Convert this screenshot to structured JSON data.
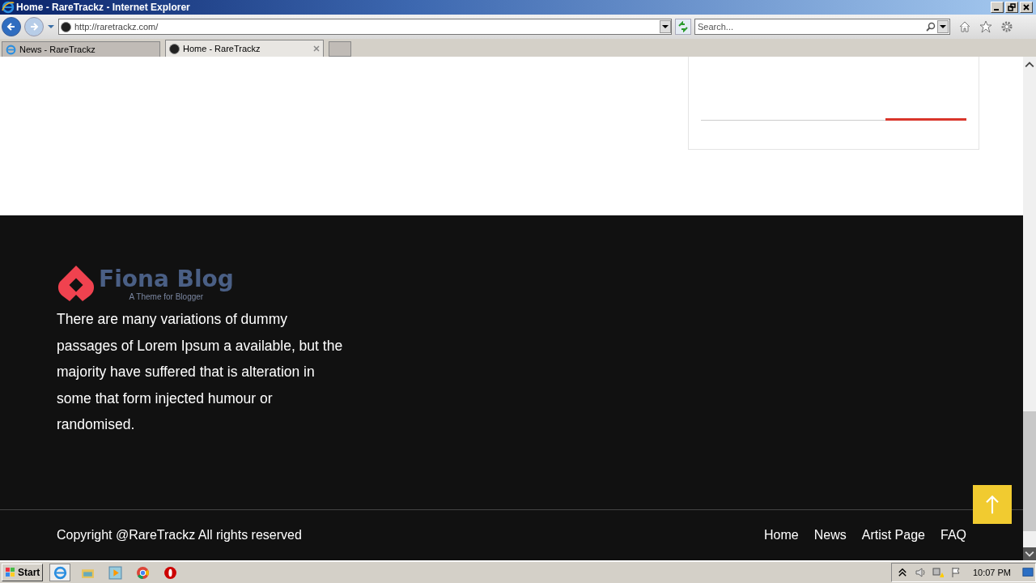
{
  "window": {
    "title": "Home - RareTrackz - Internet Explorer"
  },
  "address_bar": {
    "url": "http://raretrackz.com/"
  },
  "search": {
    "placeholder": "Search..."
  },
  "tabs": [
    {
      "label": "News - RareTrackz",
      "selected": false,
      "kind": "ie"
    },
    {
      "label": "Home - RareTrackz",
      "selected": true,
      "kind": "site"
    }
  ],
  "footer": {
    "logo": {
      "name": "Fiona Blog",
      "tagline": "A Theme for Blogger"
    },
    "about": "There are many variations of dummy passages of Lorem Ipsum a available, but the majority have suffered that is alteration in some that form injected humour or randomised.",
    "copyright": "Copyright @RareTrackz All rights reserved",
    "links": [
      "Home",
      "News",
      "Artist Page",
      "FAQ"
    ]
  },
  "taskbar": {
    "start": "Start",
    "clock": "10:07 PM"
  }
}
